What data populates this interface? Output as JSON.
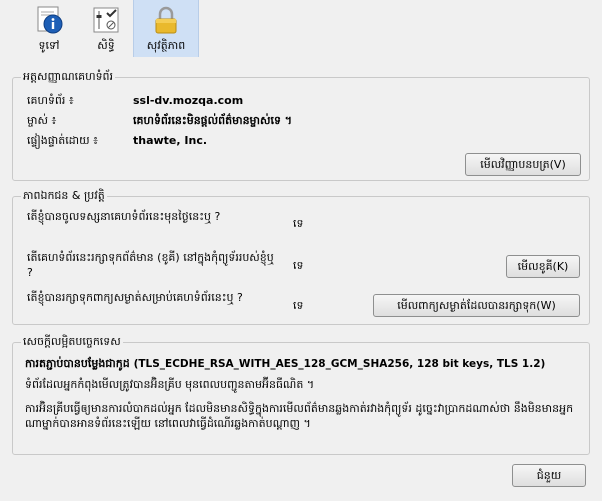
{
  "toolbar": {
    "general_label": "ទូទៅ",
    "permissions_label": "សិទ្ធិ",
    "security_label": "សុវត្ថិភាព"
  },
  "identity": {
    "title": "អត្តសញ្ញាណ​គេហទំព័រ",
    "website_label": "គេហទំព័រ ៖",
    "website_value": "ssl-dv.mozqa.com",
    "owner_label": "ម្ចាស់ ៖",
    "owner_value": "គេហទំព័រ​នេះ​មិន​ផ្ដល់​ព័ត៌មាន​ម្ចាស់​ទេ ។",
    "verifier_label": "ផ្ទៀងផ្ទាត់​ដោយ ៖",
    "verifier_value": "thawte, Inc.",
    "view_cert_button": "មើល​វិញ្ញាបនបត្រ(V)"
  },
  "privacy": {
    "title": "ភាព​ឯកជន & ប្រវត្តិ",
    "q1": "តើ​ខ្ញុំ​បាន​ចូល​ទស្សនា​គេហទំព័រ​នេះ​មុន​ថ្ងៃ​នេះ​ឬ ?",
    "a1": "ទេ",
    "q2": "តើ​គេហទំព័រ​នេះ​រក្សាទុក​ព័ត៌មាន (ខូគី) នៅ​ក្នុង​កុំព្យូទ័រ​របស់​ខ្ញុំ​ឬ ?",
    "a2": "ទេ",
    "cookies_button": "មើល​ខូគី(K)",
    "q3": "តើ​ខ្ញុំ​បាន​រក្សាទុក​ពាក្យសម្ងាត់​សម្រាប់​គេហទំព័រ​នេះ​ឬ ?",
    "a3": "ទេ",
    "passwords_button": "មើល​ពាក្យសម្ងាត់​ដែល​បាន​រក្សាទុក(W)"
  },
  "technical": {
    "title": "សេចក្ដី​លម្អិត​បច្ចេកទេស",
    "line1_prefix": "ការ​តភ្ជាប់​បាន​បម្លែង​ជា​កូដ",
    "line1_cipher": "(TLS_ECDHE_RSA_WITH_AES_128_GCM_SHA256, 128 bit keys, TLS 1.2)",
    "line2": "ទំព័រ​ដែល​អ្នក​កំពុង​មើល​ត្រូវ​បាន​អ៊ិនគ្រីប​ មុន​ពេល​បញ្ជូន​តាម​អ៊ីនធឺណិត ។",
    "line3": "ការ​អ៊ិនគ្រីប​ធ្វើ​ឲ្យ​មាន​ការ​លំបាក​ដល់​អ្នក​ ដែល​មិនមាន​សិទ្ធិ​ក្នុងការ​មើល​ព័ត៌មាន​ឆ្លងកាត់​រវាង​កុំព្យូទ័រ​ ដូច្នេះ​វា​ប្រាកដ​ណាស់​ថា​ នឹង​មិនមាន​អ្នក​ណាម្នាក់​បាន​អាន​ទំព័រ​នេះ​ឡើយ នៅពេល​វា​ធ្វើ​ដំណើរ​ឆ្លងកាត់​បណ្ដាញ ។"
  },
  "footer": {
    "help_button": "ជំនួយ"
  },
  "colors": {
    "group_border": "#c9c9c9",
    "selected_tab": "#cfe0f5",
    "background": "#f0f0f0"
  }
}
